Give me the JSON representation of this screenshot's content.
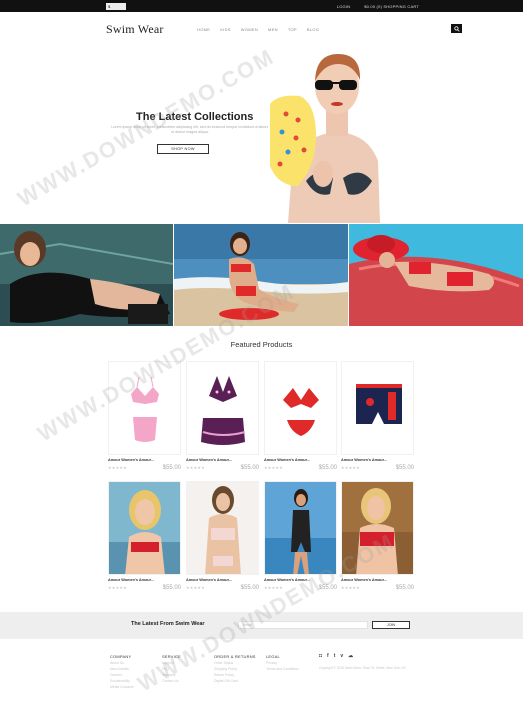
{
  "topbar": {
    "currency_code": "$",
    "login": "LOGIN",
    "cart": "$0.00 (0) SHOPPING CART"
  },
  "header": {
    "logo": "Swim Wear",
    "nav": [
      "HOME",
      "KIDS",
      "WOMEN",
      "MEN",
      "TOP",
      "BLOG"
    ]
  },
  "hero": {
    "title": "The Latest Collections",
    "subtitle": "Lorem ipsum dolor sit amet, consectetur adipiscing elit, sed do eiusmod tempor incididunt ut labore et dolore magna aliqua.",
    "button": "SHOP NOW"
  },
  "featured": {
    "title": "Featured Products",
    "products": [
      {
        "name": "Amour Women's Amour...",
        "stars": "★★★★★",
        "price": "$55.00"
      },
      {
        "name": "Amour Women's Amour...",
        "stars": "★★★★★",
        "price": "$55.00"
      },
      {
        "name": "Amour Women's Amour...",
        "stars": "★★★★★",
        "price": "$55.00"
      },
      {
        "name": "Amour Women's Amour...",
        "stars": "★★★★★",
        "price": "$55.00"
      },
      {
        "name": "Amour Women's Amour...",
        "stars": "★★★★★",
        "price": "$55.00"
      },
      {
        "name": "Amour Women's Amour...",
        "stars": "★★★★★",
        "price": "$55.00"
      },
      {
        "name": "Amour Women's Amour...",
        "stars": "★★★★★",
        "price": "$55.00"
      },
      {
        "name": "Amour Women's Amour...",
        "stars": "★★★★★",
        "price": "$55.00"
      }
    ]
  },
  "newsletter": {
    "title": "The Latest From Swim Wear",
    "placeholder": "Email",
    "button": "JOIN"
  },
  "footer": {
    "columns": [
      {
        "heading": "COMPANY",
        "links": [
          "About Us",
          "New Arrivals",
          "Careers",
          "Sustainability",
          "Media Contacts"
        ]
      },
      {
        "heading": "SERVICE",
        "links": [
          "Support",
          "FAQ",
          "Warranty",
          "Contact Us"
        ]
      },
      {
        "heading": "ORDER & RETURNS",
        "links": [
          "Order Status",
          "Shipping Policy",
          "Return Policy",
          "Digital Gift Card"
        ]
      },
      {
        "heading": "LEGAL",
        "links": [
          "Privacy",
          "Terms and Conditions"
        ]
      }
    ],
    "socials": [
      "instagram-icon",
      "facebook-icon",
      "twitter-icon",
      "vimeo-icon",
      "cloud-icon"
    ],
    "address": "Copyright © 2016 Swim Wear. Store St. Street, New York, NY."
  },
  "watermark": "WWW.DOWNDEMO.COM",
  "colors": {
    "topbar": "#111111",
    "newsletter_bg": "#eeeeee",
    "accent_red": "#e02a2a"
  }
}
